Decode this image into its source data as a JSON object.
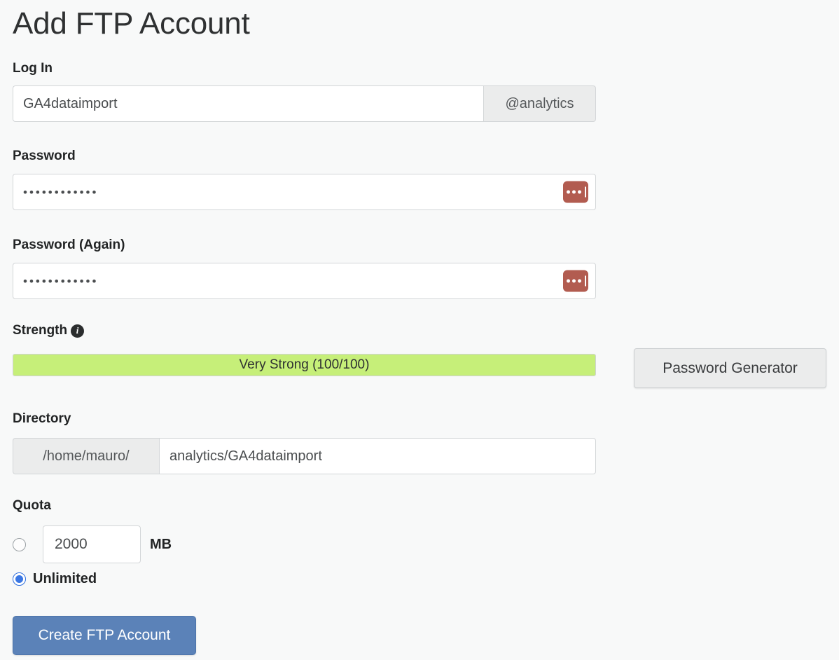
{
  "page": {
    "title": "Add FTP Account",
    "background_color": "#f8f9f9"
  },
  "login": {
    "label": "Log In",
    "value": "GA4dataimport",
    "placeholder": "",
    "domain_suffix": "@analytics"
  },
  "password": {
    "label": "Password",
    "masked_value": "••••••••••••",
    "character_count": 12,
    "reveal_icon": "password-reveal-icon",
    "reveal_icon_color": "#b25c50"
  },
  "password_again": {
    "label": "Password (Again)",
    "masked_value": "••••••••••••",
    "character_count": 12,
    "reveal_icon": "password-reveal-icon",
    "reveal_icon_color": "#b25c50"
  },
  "strength": {
    "label": "Strength",
    "info_icon": "info-icon",
    "info_glyph": "i",
    "text": "Very Strong (100/100)",
    "score": 100,
    "max_score": 100,
    "percent": 100,
    "fill_color": "#c6ef79"
  },
  "password_generator": {
    "label": "Password Generator"
  },
  "directory": {
    "label": "Directory",
    "prefix": "/home/mauro/",
    "value": "analytics/GA4dataimport",
    "placeholder": ""
  },
  "quota": {
    "label": "Quota",
    "size_value": "2000",
    "size_unit": "MB",
    "size_selected": false,
    "unlimited_label": "Unlimited",
    "unlimited_selected": true,
    "selected_accent": "#3b77e3"
  },
  "submit": {
    "label": "Create FTP Account",
    "color": "#5b82b8"
  }
}
